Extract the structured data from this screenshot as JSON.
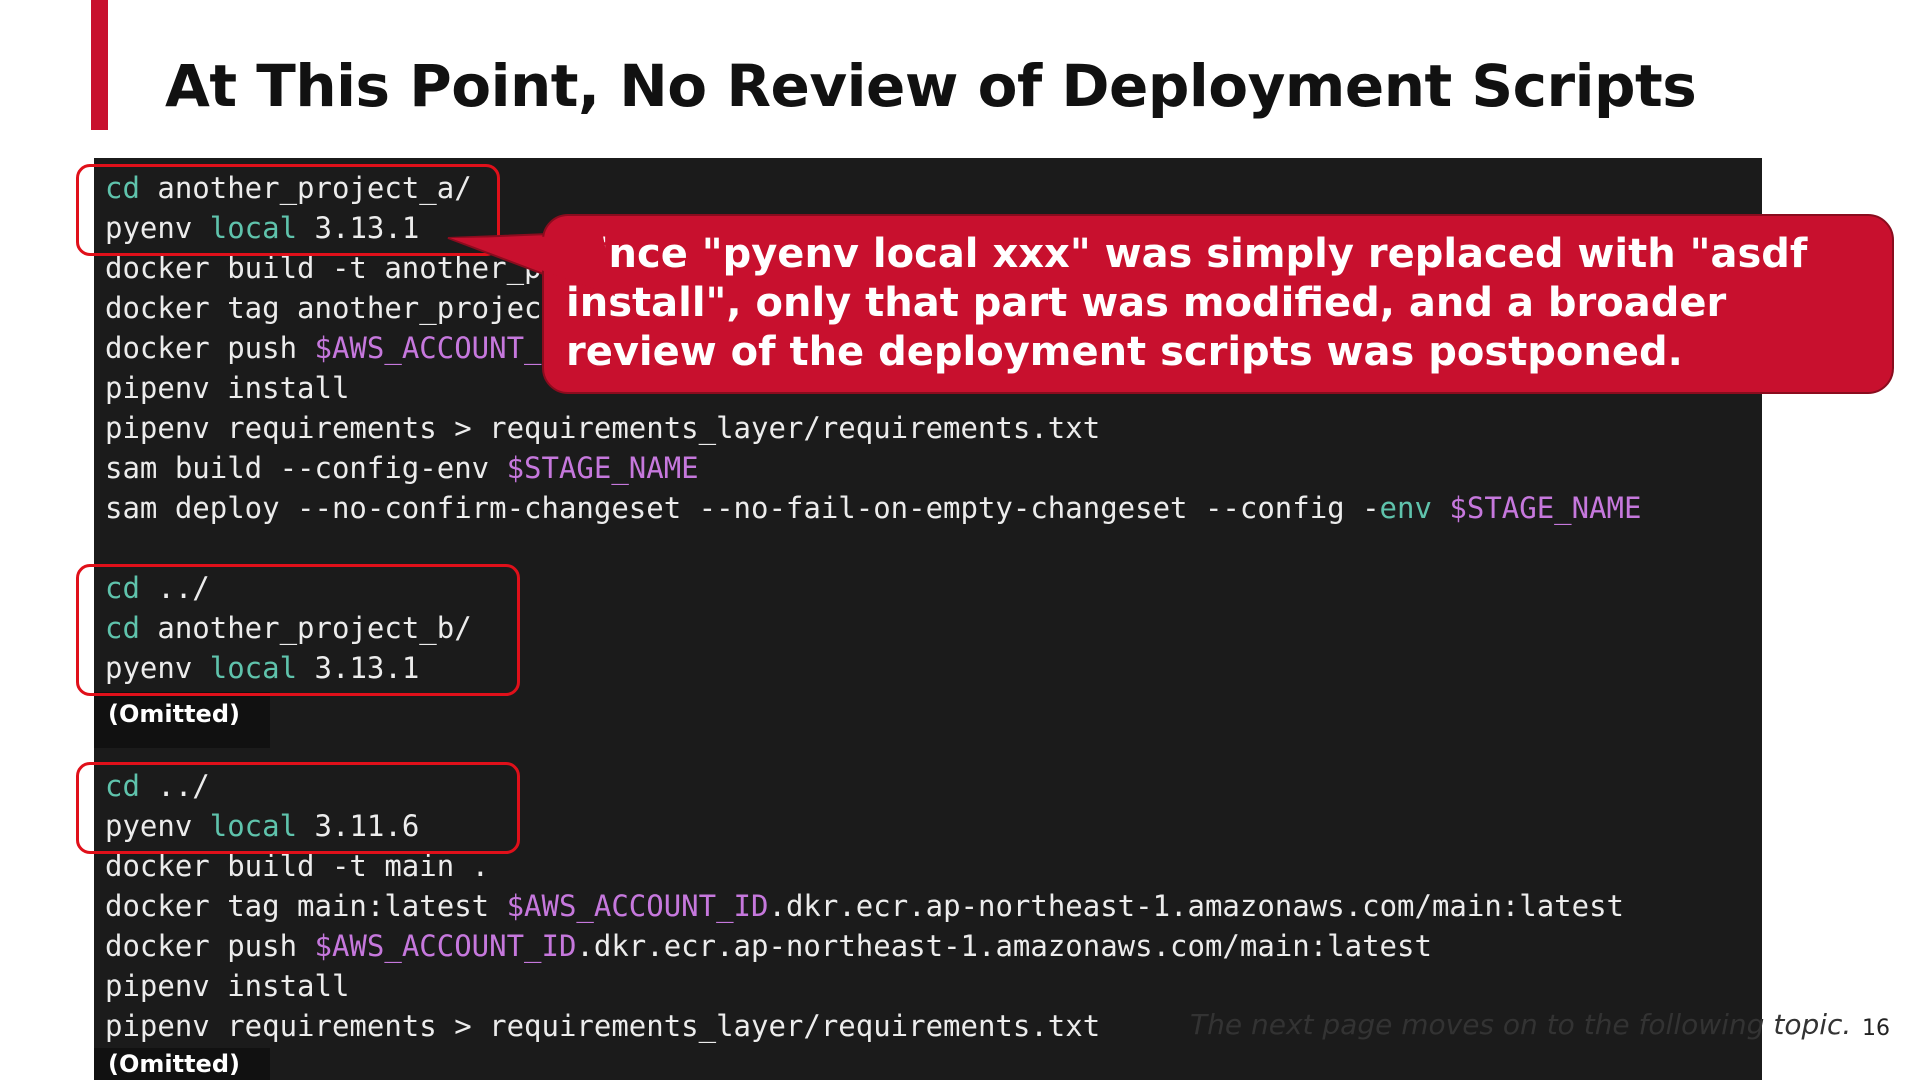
{
  "slide": {
    "title": "At This Point, No Review of Deployment Scripts",
    "accent_color": "#c8102e",
    "page_number": "16",
    "footer_note": "The next page moves on to the following topic."
  },
  "terminal": {
    "background": "#1b1b1b",
    "block_a": [
      {
        "cmd": "cd",
        "rest": " another_project_a/"
      },
      {
        "pre": "pyenv ",
        "kw": "local",
        "rest": " 3.13.1"
      },
      {
        "text": "docker build -t another_project_a ."
      },
      {
        "text": "docker tag another_project_a:latest "
      },
      {
        "pre": "docker push ",
        "var": "$AWS_ACCOUNT_ID",
        "rest": ""
      },
      {
        "text": "pipenv install"
      },
      {
        "text": "pipenv requirements > requirements_layer/requirements.txt"
      },
      {
        "pre": "sam build --config-env ",
        "var": "$STAGE_NAME"
      },
      {
        "pre": "sam deploy --no-confirm-changeset --no-fail-on-empty-changeset --config -",
        "kw": "env",
        "var": "$STAGE_NAME"
      }
    ],
    "block_b": [
      {
        "cmd": "cd",
        "rest": " ../"
      },
      {
        "cmd": "cd",
        "rest": " another_project_b/"
      },
      {
        "pre": "pyenv ",
        "kw": "local",
        "rest": " 3.13.1"
      }
    ],
    "omitted_label": "(Omitted)",
    "block_c": [
      {
        "cmd": "cd",
        "rest": " ../"
      },
      {
        "pre": "pyenv ",
        "kw": "local",
        "rest": " 3.11.6"
      },
      {
        "text": "docker build -t main ."
      },
      {
        "pre": "docker tag main:latest ",
        "var": "$AWS_ACCOUNT_ID",
        "rest": ".dkr.ecr.ap-northeast-1.amazonaws.com/main:latest"
      },
      {
        "pre": "docker push ",
        "var": "$AWS_ACCOUNT_ID",
        "rest": ".dkr.ecr.ap-northeast-1.amazonaws.com/main:latest"
      },
      {
        "text": "pipenv install"
      },
      {
        "text": "pipenv requirements > requirements_layer/requirements.txt"
      }
    ],
    "omitted_label_2": "(Omitted)"
  },
  "callout": {
    "text": "Since \"pyenv local xxx\" was simply replaced with \"asdf install\", only that part was modified, and a broader review of the deployment scripts was postponed.",
    "color": "#c8102e"
  }
}
